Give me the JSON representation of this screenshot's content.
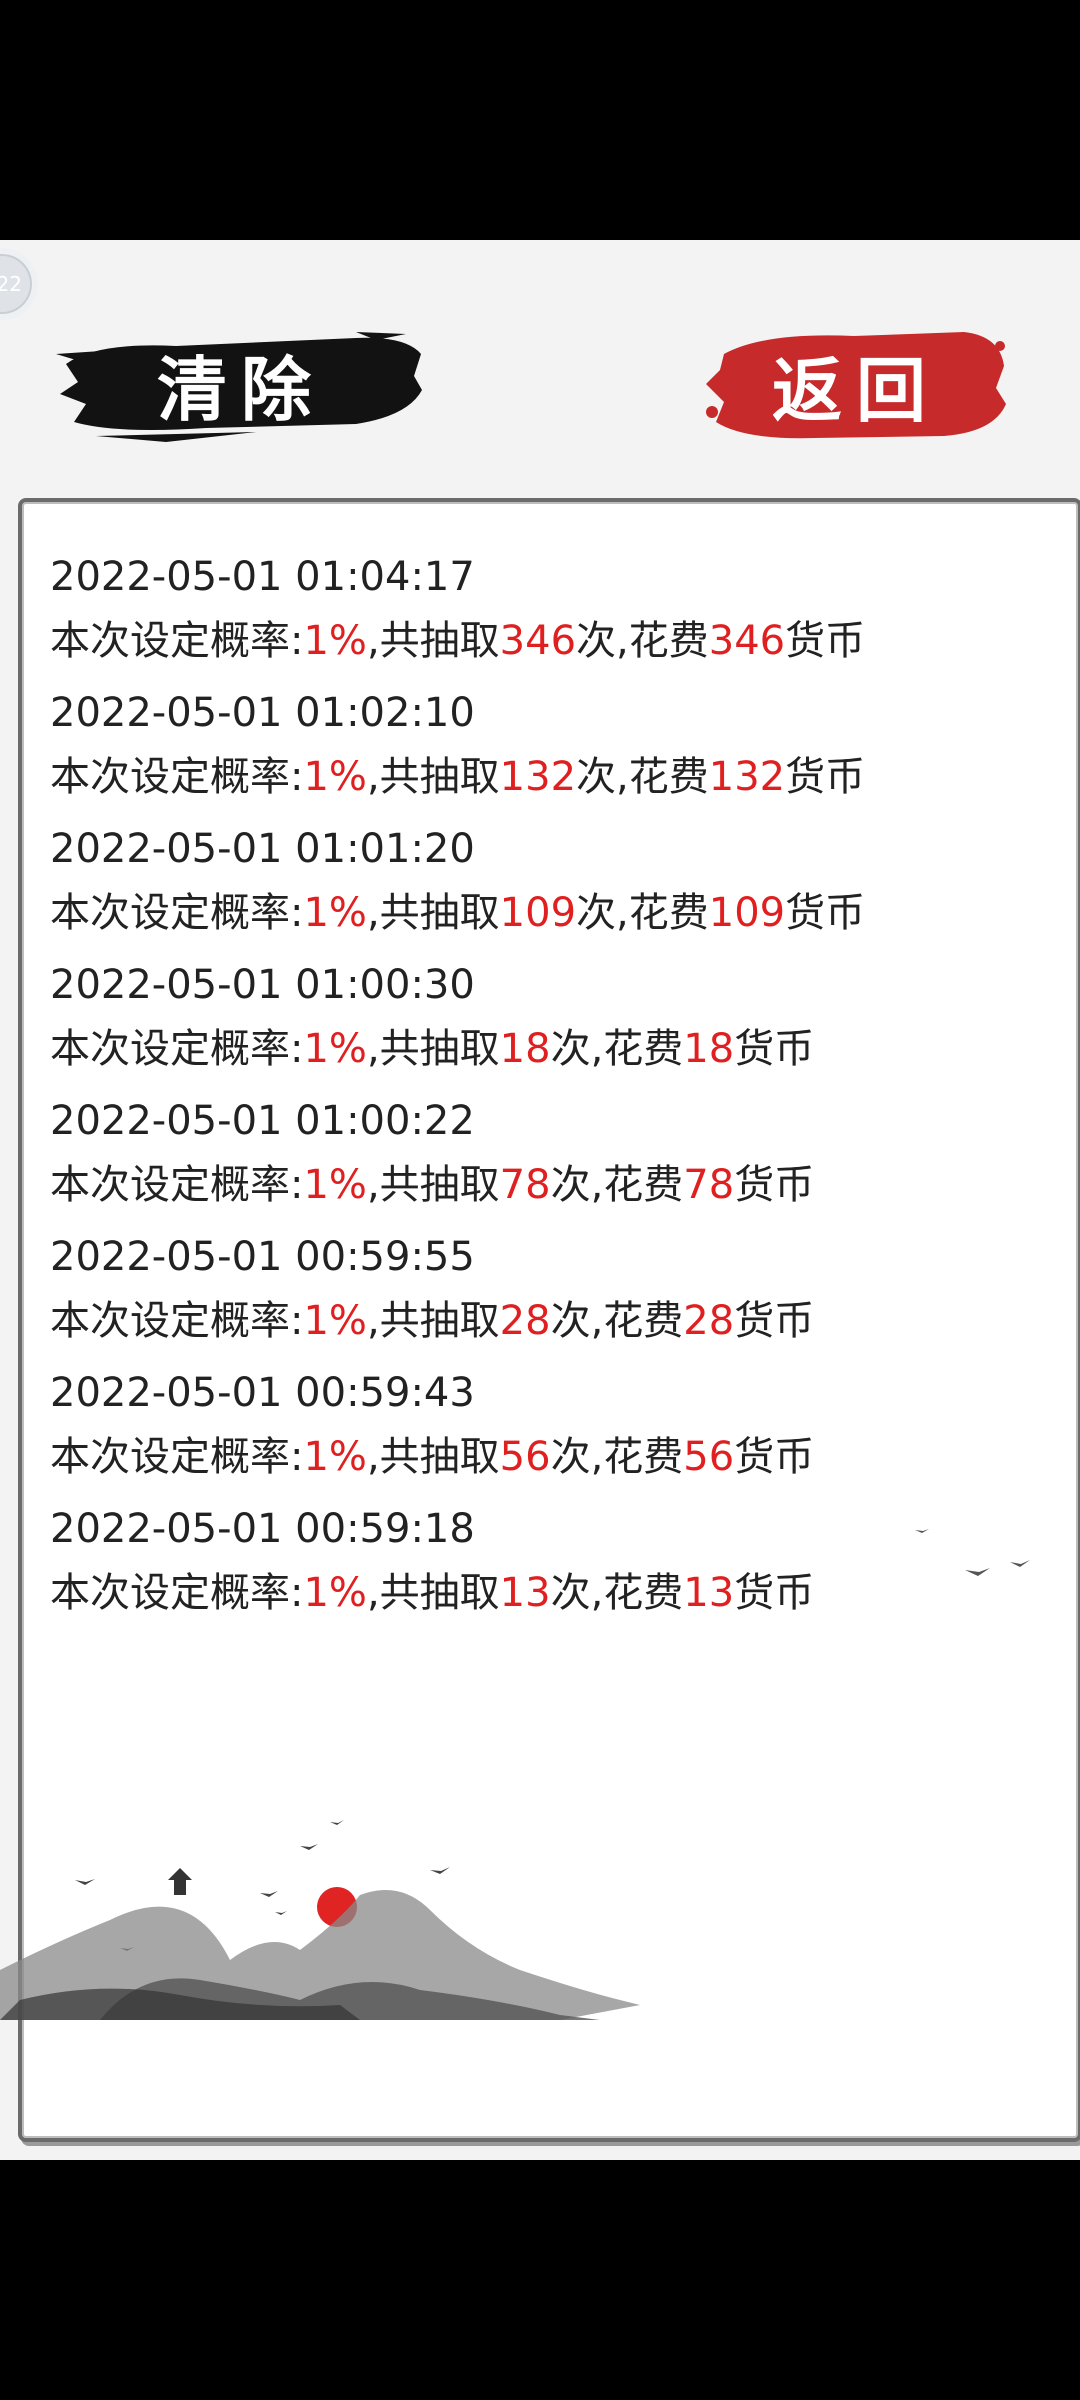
{
  "buttons": {
    "clear_label": "清除",
    "back_label": "返回"
  },
  "corner_badge": "22",
  "records": [
    {
      "time": "2022-05-01 01:04:17",
      "prefix": "本次设定概率:",
      "rate": "1%",
      "mid1": ",共抽取",
      "draws": "346",
      "mid2": "次,花费",
      "cost": "346",
      "suffix": "货币"
    },
    {
      "time": "2022-05-01 01:02:10",
      "prefix": "本次设定概率:",
      "rate": "1%",
      "mid1": ",共抽取",
      "draws": "132",
      "mid2": "次,花费",
      "cost": "132",
      "suffix": "货币"
    },
    {
      "time": "2022-05-01 01:01:20",
      "prefix": "本次设定概率:",
      "rate": "1%",
      "mid1": ",共抽取",
      "draws": "109",
      "mid2": "次,花费",
      "cost": "109",
      "suffix": "货币"
    },
    {
      "time": "2022-05-01 01:00:30",
      "prefix": "本次设定概率:",
      "rate": "1%",
      "mid1": ",共抽取",
      "draws": "18",
      "mid2": "次,花费",
      "cost": "18",
      "suffix": "货币"
    },
    {
      "time": "2022-05-01 01:00:22",
      "prefix": "本次设定概率:",
      "rate": "1%",
      "mid1": ",共抽取",
      "draws": "78",
      "mid2": "次,花费",
      "cost": "78",
      "suffix": "货币"
    },
    {
      "time": "2022-05-01 00:59:55",
      "prefix": "本次设定概率:",
      "rate": "1%",
      "mid1": ",共抽取",
      "draws": "28",
      "mid2": "次,花费",
      "cost": "28",
      "suffix": "货币"
    },
    {
      "time": "2022-05-01 00:59:43",
      "prefix": "本次设定概率:",
      "rate": "1%",
      "mid1": ",共抽取",
      "draws": "56",
      "mid2": "次,花费",
      "cost": "56",
      "suffix": "货币"
    },
    {
      "time": "2022-05-01 00:59:18",
      "prefix": "本次设定概率:",
      "rate": "1%",
      "mid1": ",共抽取",
      "draws": "13",
      "mid2": "次,花费",
      "cost": "13",
      "suffix": "货币"
    }
  ],
  "colors": {
    "accent_red": "#e02020",
    "ink": "#111111",
    "seal_red": "#c62a2a"
  }
}
